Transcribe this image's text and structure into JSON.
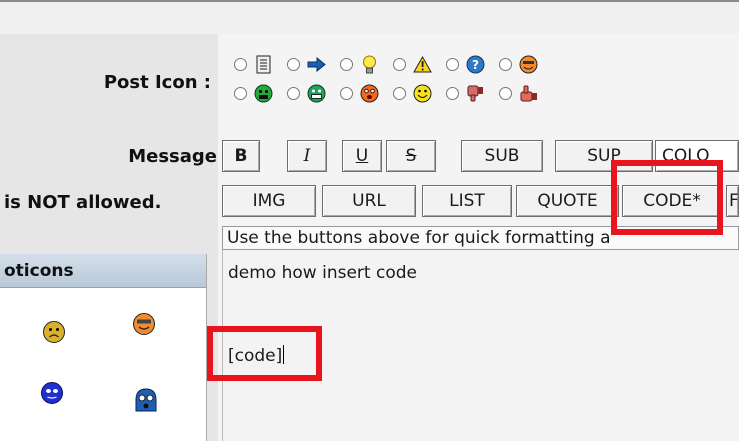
{
  "labels": {
    "post_icon": "Post Icon :",
    "message": "Message",
    "not_allowed": "is NOT allowed."
  },
  "post_icons": {
    "row1": [
      "document-icon",
      "arrow-right-icon",
      "lightbulb-icon",
      "warning-icon",
      "question-icon",
      "cool-face-icon"
    ],
    "row2": [
      "angry-face-icon",
      "grin-face-icon",
      "shocked-face-icon",
      "smile-face-icon",
      "thumbs-down-icon",
      "thumbs-up-icon"
    ]
  },
  "toolbar": {
    "row1": [
      "B",
      "I",
      "U",
      "S",
      "SUB",
      "SUP",
      "COLO"
    ],
    "row2": [
      "IMG",
      "URL",
      "LIST",
      "QUOTE",
      "CODE*",
      "F"
    ]
  },
  "hint": "Use the buttons above for quick formatting a",
  "message": {
    "line1": "demo how insert code",
    "line2": "[code]"
  },
  "emoticons": {
    "title": "oticons",
    "icons": [
      "sad-face-icon",
      "cool-face-icon",
      "blue-face-icon",
      "scared-face-icon"
    ]
  },
  "colors": {
    "highlight": "#e8141e",
    "panel_header": "#c6d4e2"
  }
}
